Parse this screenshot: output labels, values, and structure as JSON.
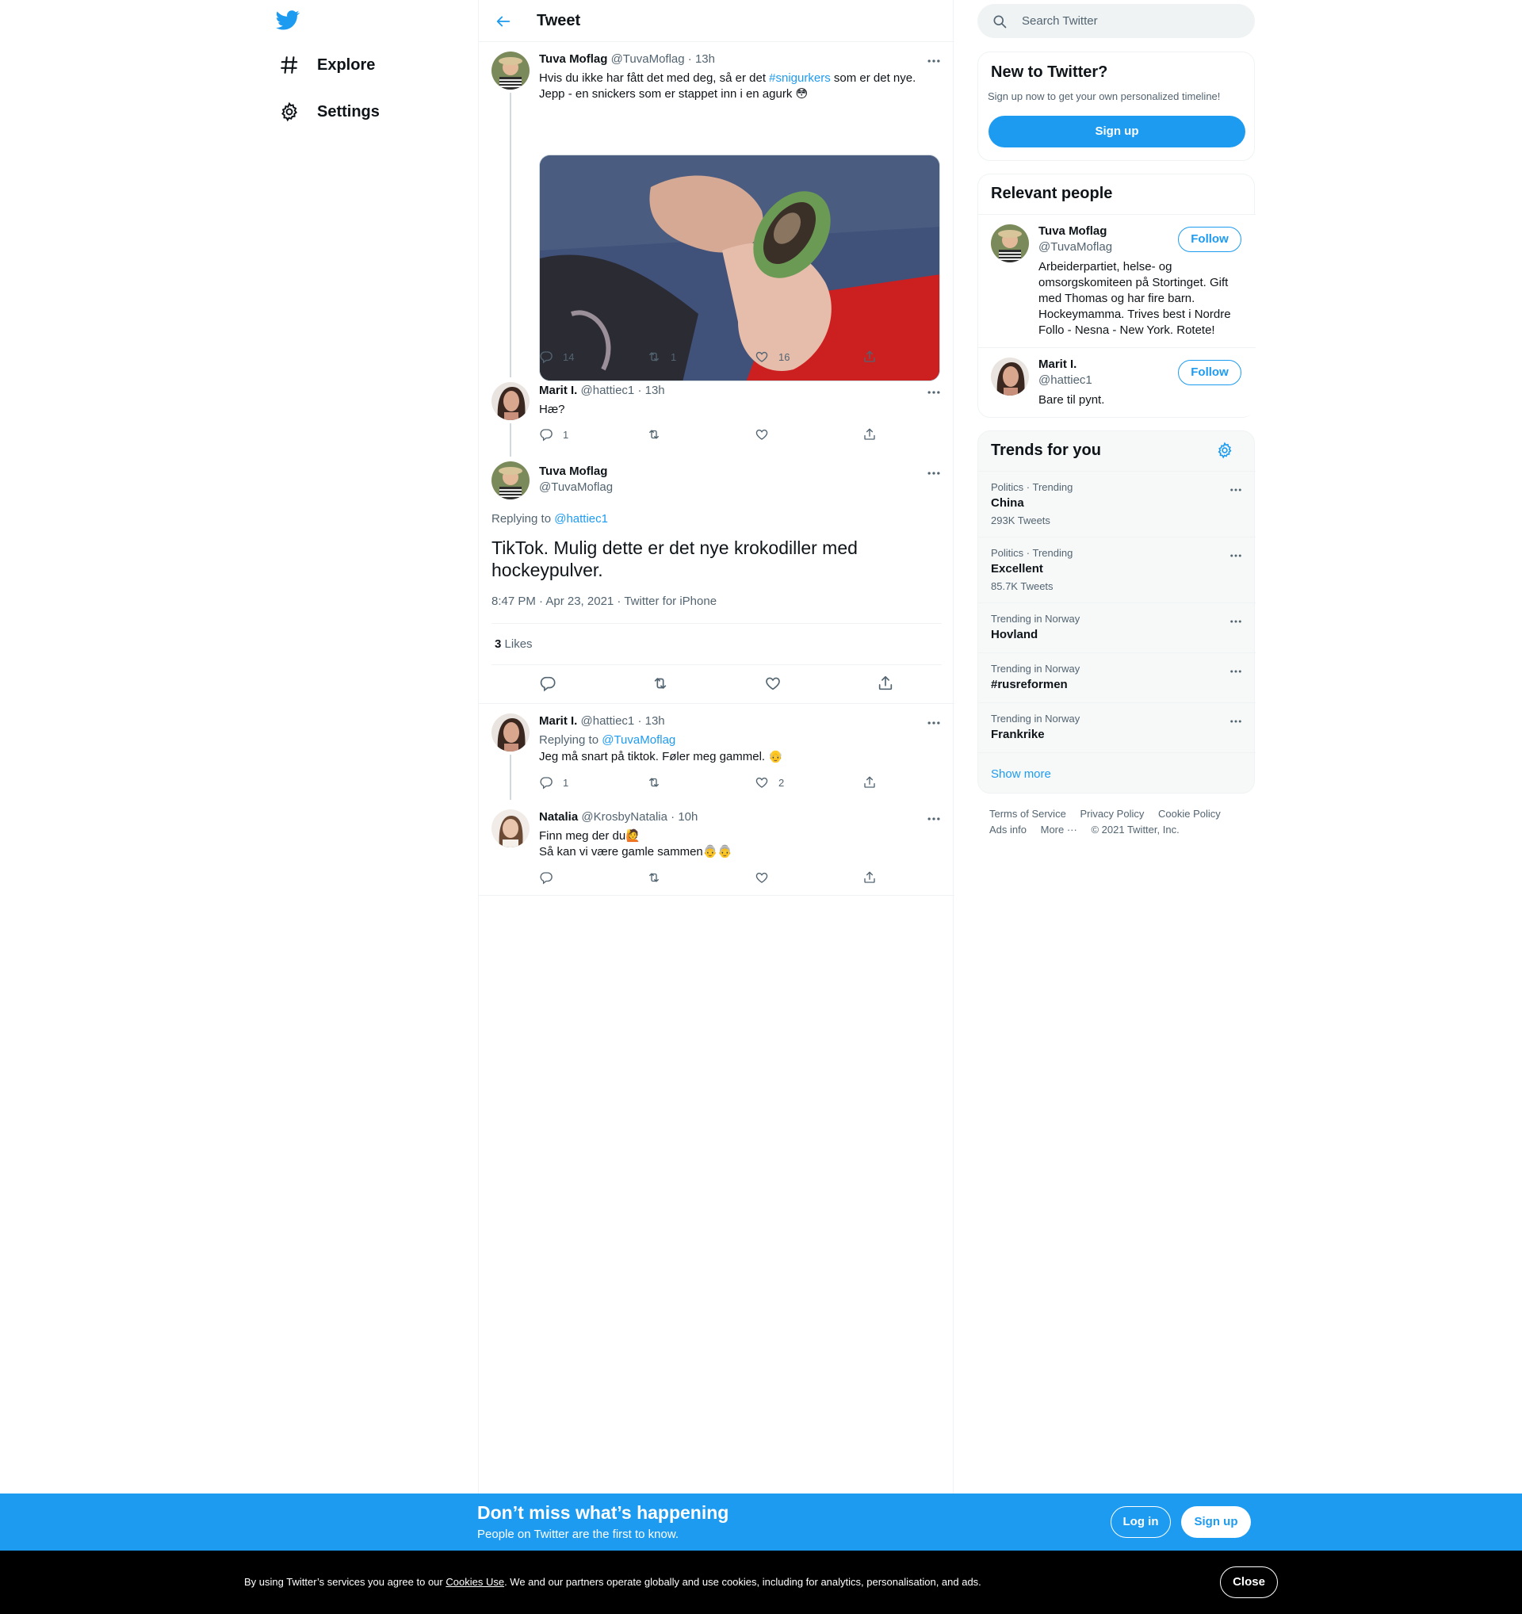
{
  "colors": {
    "brand": "#1d9bf0",
    "text": "#0f1419",
    "muted": "#536471",
    "border": "#eff3f4"
  },
  "nav": {
    "items": [
      {
        "label": "Explore",
        "icon": "hashtag-icon"
      },
      {
        "label": "Settings",
        "icon": "gear-icon"
      }
    ]
  },
  "header": {
    "title": "Tweet"
  },
  "tweets": [
    {
      "name": "Tuva Moflag",
      "handle": "@TuvaMoflag",
      "time": "· 13h",
      "text_before": "Hvis du ikke har fått det med deg, så er det ",
      "hashtag": "#snigurkers",
      "text_after": " som er det nye.",
      "text_line2": "Jepp - en snickers som er stappet inn i en agurk 😳",
      "replies": "14",
      "retweets": "1",
      "likes": "16"
    },
    {
      "name": "Marit I.",
      "handle": "@hattiec1",
      "time": "· 13h",
      "text": "Hæ?",
      "replies": "1",
      "retweets": "",
      "likes": ""
    }
  ],
  "focus": {
    "name": "Tuva Moflag",
    "handle": "@TuvaMoflag",
    "replying_label": "Replying to ",
    "replying_to": "@hattiec1",
    "text": "TikTok. Mulig dette er det nye krokodiller med hockeypulver.",
    "meta": "8:47 PM · Apr 23, 2021 · Twitter for iPhone",
    "likes_count": "3",
    "likes_label": "Likes"
  },
  "replies": [
    {
      "name": "Marit I.",
      "handle": "@hattiec1",
      "time": "· 13h",
      "replying_label": "Replying to ",
      "replying_to": "@TuvaMoflag",
      "text": "Jeg må snart på tiktok. Føler meg gammel. 👴",
      "replies": "1",
      "retweets": "",
      "likes": "2"
    },
    {
      "name": "Natalia",
      "handle": "@KrosbyNatalia",
      "time": "· 10h",
      "text": "Finn meg der du🙋",
      "text_line2": "Så kan vi være gamle sammen👵👵",
      "replies": "",
      "retweets": "",
      "likes": ""
    }
  ],
  "search": {
    "placeholder": "Search Twitter"
  },
  "new_to_twitter": {
    "title": "New to Twitter?",
    "subtitle": "Sign up now to get your own personalized timeline!",
    "button": "Sign up"
  },
  "relevant": {
    "title": "Relevant people",
    "people": [
      {
        "name": "Tuva Moflag",
        "handle": "@TuvaMoflag",
        "bio": "Arbeiderpartiet, helse- og omsorgskomiteen på Stortinget. Gift med Thomas og har fire barn. Hockeymamma. Trives best i Nordre Follo - Nesna - New York. Rotete!",
        "button": "Follow"
      },
      {
        "name": "Marit I.",
        "handle": "@hattiec1",
        "bio": "Bare til pynt.",
        "button": "Follow"
      }
    ]
  },
  "trends": {
    "title": "Trends for you",
    "items": [
      {
        "context": "Politics · Trending",
        "name": "China",
        "count": "293K Tweets"
      },
      {
        "context": "Politics · Trending",
        "name": "Excellent",
        "count": "85.7K Tweets"
      },
      {
        "context": "Trending in Norway",
        "name": "Hovland",
        "count": ""
      },
      {
        "context": "Trending in Norway",
        "name": "#rusreformen",
        "count": ""
      },
      {
        "context": "Trending in Norway",
        "name": "Frankrike",
        "count": ""
      }
    ],
    "show_more": "Show more"
  },
  "footer": {
    "links": [
      "Terms of Service",
      "Privacy Policy",
      "Cookie Policy"
    ],
    "links2": [
      "Ads info",
      "More ···",
      "© 2021 Twitter, Inc."
    ]
  },
  "promo": {
    "title": "Don’t miss what’s happening",
    "subtitle": "People on Twitter are the first to know.",
    "login": "Log in",
    "signup": "Sign up"
  },
  "cookie": {
    "before": "By using Twitter’s services you agree to our ",
    "link": "Cookies Use",
    "after": ". We and our partners operate globally and use cookies, including for analytics, personalisation, and ads.",
    "close": "Close"
  }
}
